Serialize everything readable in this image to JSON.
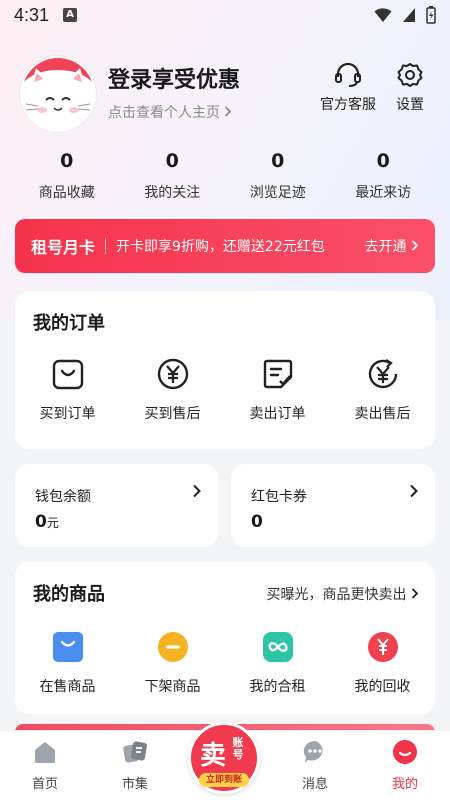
{
  "status_bar": {
    "time": "4:31",
    "badge": "A"
  },
  "profile": {
    "name": "登录享受优惠",
    "link": "点击查看个人主页",
    "service_label": "官方客服",
    "settings_label": "设置"
  },
  "stats": [
    {
      "value": "0",
      "label": "商品收藏"
    },
    {
      "value": "0",
      "label": "我的关注"
    },
    {
      "value": "0",
      "label": "浏览足迹"
    },
    {
      "value": "0",
      "label": "最近来访"
    }
  ],
  "promo": {
    "title": "租号月卡",
    "desc": "开卡即享9折购，还赠送22元红包",
    "cta": "去开通"
  },
  "orders": {
    "title": "我的订单",
    "items": [
      {
        "label": "买到订单",
        "icon": "bag-icon"
      },
      {
        "label": "买到售后",
        "icon": "yen-circle-icon"
      },
      {
        "label": "卖出订单",
        "icon": "order-note-icon"
      },
      {
        "label": "卖出售后",
        "icon": "yen-refresh-icon"
      }
    ]
  },
  "wallet": {
    "balance_label": "钱包余额",
    "balance_value": "0",
    "balance_unit": "元",
    "coupon_label": "红包卡券",
    "coupon_value": "0"
  },
  "goods": {
    "title": "我的商品",
    "promo_link": "买曝光，商品更快卖出",
    "items": [
      {
        "label": "在售商品",
        "icon": "on-sale-icon",
        "color": "#4a8ff0"
      },
      {
        "label": "下架商品",
        "icon": "off-shelf-icon",
        "color": "#f5b324"
      },
      {
        "label": "我的合租",
        "icon": "share-rent-icon",
        "color": "#2ec4a6"
      },
      {
        "label": "我的回收",
        "icon": "recycle-icon",
        "color": "#f0414f"
      }
    ]
  },
  "tabbar": {
    "tabs": [
      {
        "label": "首页",
        "icon": "home-icon"
      },
      {
        "label": "市集",
        "icon": "market-icon"
      },
      {
        "label": "消息",
        "icon": "message-icon"
      },
      {
        "label": "我的",
        "icon": "profile-icon"
      }
    ],
    "sell": {
      "main": "卖",
      "side": "账号",
      "tag": "立即到账"
    }
  },
  "colors": {
    "accent": "#f2334c",
    "background": "#f4f5f7"
  }
}
